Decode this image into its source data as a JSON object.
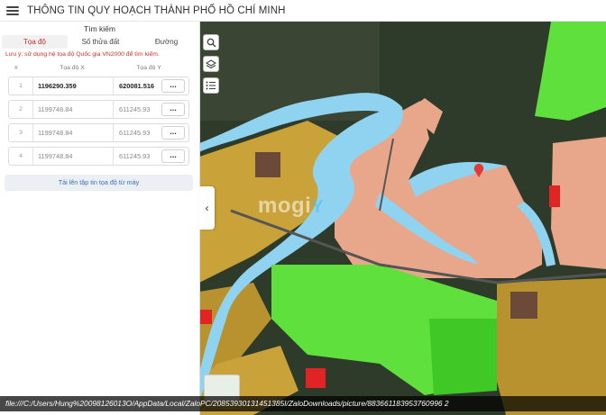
{
  "header": {
    "title": "THÔNG TIN QUY HOẠCH THÀNH PHỐ HỒ CHÍ MINH",
    "menu_icon": "hamburger-icon"
  },
  "panel": {
    "title": "Tìm kiếm",
    "tabs": [
      {
        "label": "Tọa độ",
        "active": true
      },
      {
        "label": "Số thửa đất",
        "active": false
      },
      {
        "label": "Đường",
        "active": false
      }
    ],
    "note": "Lưu ý: sử dụng hệ tọa độ Quốc gia VN2000 để tìm kiếm.",
    "columns": {
      "index": "#",
      "x": "Tọa độ X",
      "y": "Tọa độ Y"
    },
    "rows": [
      {
        "index": "1",
        "x": "1196290.359",
        "y": "620081.516",
        "action": "..."
      },
      {
        "index": "2",
        "x": "1199748.84",
        "y": "611245.93",
        "action": "..."
      },
      {
        "index": "3",
        "x": "1199748.84",
        "y": "611245.93",
        "action": "..."
      },
      {
        "index": "4",
        "x": "1199748.84",
        "y": "611245.93",
        "action": "..."
      }
    ],
    "upload_label": "Tải lên tập tin tọa độ từ máy"
  },
  "map": {
    "watermark_main": "mogi",
    "watermark_suffix": "Y",
    "tools": [
      "search-icon",
      "layers-icon",
      "list-icon"
    ],
    "colors": {
      "water": "#8fd3f0",
      "residential": "#e8a68a",
      "green": "#5fe03c",
      "agri": "#c9a23a",
      "red": "#e02424",
      "dark_land": "#2c3a26"
    }
  },
  "footer": {
    "path": "file:///C:/Users/Hung%20098126013O/AppData/Local/ZaloPC/20853930131451385I/ZaloDownloads/picture/883661183953760996 2"
  }
}
